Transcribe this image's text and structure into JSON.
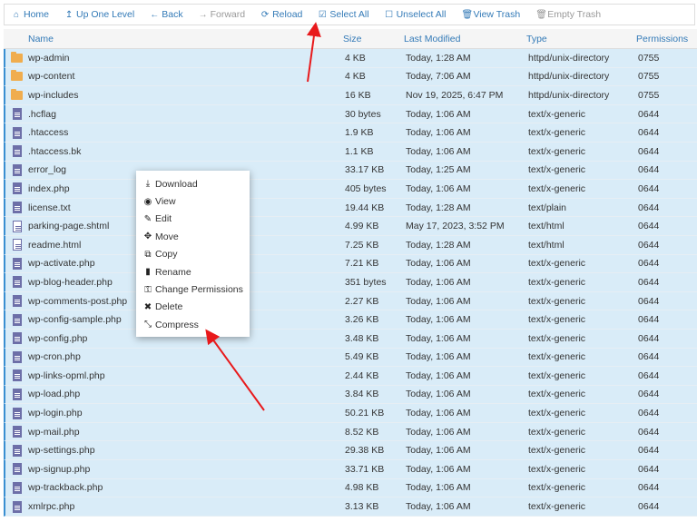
{
  "toolbar": [
    {
      "label": "Home",
      "icon": "home-icon",
      "glyph": "⌂",
      "disabled": false
    },
    {
      "label": "Up One Level",
      "icon": "level-up-icon",
      "glyph": "↥",
      "disabled": false
    },
    {
      "label": "Back",
      "icon": "arrow-left-icon",
      "glyph": "←",
      "disabled": false
    },
    {
      "label": "Forward",
      "icon": "arrow-right-icon",
      "glyph": "→",
      "disabled": true
    },
    {
      "label": "Reload",
      "icon": "refresh-icon",
      "glyph": "⟳",
      "disabled": false
    },
    {
      "label": "Select All",
      "icon": "checkbox-checked-icon",
      "glyph": "☑",
      "disabled": false
    },
    {
      "label": "Unselect All",
      "icon": "checkbox-empty-icon",
      "glyph": "☐",
      "disabled": false
    },
    {
      "label": "View Trash",
      "icon": "trash-icon",
      "glyph": "🗑",
      "disabled": false
    },
    {
      "label": "Empty Trash",
      "icon": "trash-icon",
      "glyph": "🗑",
      "disabled": true
    }
  ],
  "columns": [
    "Name",
    "Size",
    "Last Modified",
    "Type",
    "Permissions"
  ],
  "files": [
    {
      "name": "wp-admin",
      "size": "4 KB",
      "modified": "Today, 1:28 AM",
      "type": "httpd/unix-directory",
      "perm": "0755",
      "kind": "folder"
    },
    {
      "name": "wp-content",
      "size": "4 KB",
      "modified": "Today, 7:06 AM",
      "type": "httpd/unix-directory",
      "perm": "0755",
      "kind": "folder"
    },
    {
      "name": "wp-includes",
      "size": "16 KB",
      "modified": "Nov 19, 2025, 6:47 PM",
      "type": "httpd/unix-directory",
      "perm": "0755",
      "kind": "folder"
    },
    {
      "name": ".hcflag",
      "size": "30 bytes",
      "modified": "Today, 1:06 AM",
      "type": "text/x-generic",
      "perm": "0644",
      "kind": "file"
    },
    {
      "name": ".htaccess",
      "size": "1.9 KB",
      "modified": "Today, 1:06 AM",
      "type": "text/x-generic",
      "perm": "0644",
      "kind": "file"
    },
    {
      "name": ".htaccess.bk",
      "size": "1.1 KB",
      "modified": "Today, 1:06 AM",
      "type": "text/x-generic",
      "perm": "0644",
      "kind": "file"
    },
    {
      "name": "error_log",
      "size": "33.17 KB",
      "modified": "Today, 1:25 AM",
      "type": "text/x-generic",
      "perm": "0644",
      "kind": "file"
    },
    {
      "name": "index.php",
      "size": "405 bytes",
      "modified": "Today, 1:06 AM",
      "type": "text/x-generic",
      "perm": "0644",
      "kind": "file"
    },
    {
      "name": "license.txt",
      "size": "19.44 KB",
      "modified": "Today, 1:28 AM",
      "type": "text/plain",
      "perm": "0644",
      "kind": "file"
    },
    {
      "name": "parking-page.shtml",
      "size": "4.99 KB",
      "modified": "May 17, 2023, 3:52 PM",
      "type": "text/html",
      "perm": "0644",
      "kind": "html"
    },
    {
      "name": "readme.html",
      "size": "7.25 KB",
      "modified": "Today, 1:28 AM",
      "type": "text/html",
      "perm": "0644",
      "kind": "html"
    },
    {
      "name": "wp-activate.php",
      "size": "7.21 KB",
      "modified": "Today, 1:06 AM",
      "type": "text/x-generic",
      "perm": "0644",
      "kind": "file"
    },
    {
      "name": "wp-blog-header.php",
      "size": "351 bytes",
      "modified": "Today, 1:06 AM",
      "type": "text/x-generic",
      "perm": "0644",
      "kind": "file"
    },
    {
      "name": "wp-comments-post.php",
      "size": "2.27 KB",
      "modified": "Today, 1:06 AM",
      "type": "text/x-generic",
      "perm": "0644",
      "kind": "file"
    },
    {
      "name": "wp-config-sample.php",
      "size": "3.26 KB",
      "modified": "Today, 1:06 AM",
      "type": "text/x-generic",
      "perm": "0644",
      "kind": "file"
    },
    {
      "name": "wp-config.php",
      "size": "3.48 KB",
      "modified": "Today, 1:06 AM",
      "type": "text/x-generic",
      "perm": "0644",
      "kind": "file"
    },
    {
      "name": "wp-cron.php",
      "size": "5.49 KB",
      "modified": "Today, 1:06 AM",
      "type": "text/x-generic",
      "perm": "0644",
      "kind": "file"
    },
    {
      "name": "wp-links-opml.php",
      "size": "2.44 KB",
      "modified": "Today, 1:06 AM",
      "type": "text/x-generic",
      "perm": "0644",
      "kind": "file"
    },
    {
      "name": "wp-load.php",
      "size": "3.84 KB",
      "modified": "Today, 1:06 AM",
      "type": "text/x-generic",
      "perm": "0644",
      "kind": "file"
    },
    {
      "name": "wp-login.php",
      "size": "50.21 KB",
      "modified": "Today, 1:06 AM",
      "type": "text/x-generic",
      "perm": "0644",
      "kind": "file"
    },
    {
      "name": "wp-mail.php",
      "size": "8.52 KB",
      "modified": "Today, 1:06 AM",
      "type": "text/x-generic",
      "perm": "0644",
      "kind": "file"
    },
    {
      "name": "wp-settings.php",
      "size": "29.38 KB",
      "modified": "Today, 1:06 AM",
      "type": "text/x-generic",
      "perm": "0644",
      "kind": "file"
    },
    {
      "name": "wp-signup.php",
      "size": "33.71 KB",
      "modified": "Today, 1:06 AM",
      "type": "text/x-generic",
      "perm": "0644",
      "kind": "file"
    },
    {
      "name": "wp-trackback.php",
      "size": "4.98 KB",
      "modified": "Today, 1:06 AM",
      "type": "text/x-generic",
      "perm": "0644",
      "kind": "file"
    },
    {
      "name": "xmlrpc.php",
      "size": "3.13 KB",
      "modified": "Today, 1:06 AM",
      "type": "text/x-generic",
      "perm": "0644",
      "kind": "file"
    }
  ],
  "context_menu": [
    {
      "label": "Download",
      "icon": "download-icon",
      "glyph": "⤓"
    },
    {
      "label": "View",
      "icon": "eye-icon",
      "glyph": "◉"
    },
    {
      "label": "Edit",
      "icon": "pencil-icon",
      "glyph": "✎"
    },
    {
      "label": "Move",
      "icon": "move-icon",
      "glyph": "✥"
    },
    {
      "label": "Copy",
      "icon": "copy-icon",
      "glyph": "⧉"
    },
    {
      "label": "Rename",
      "icon": "file-icon",
      "glyph": "▮"
    },
    {
      "label": "Change Permissions",
      "icon": "key-icon",
      "glyph": "⚿"
    },
    {
      "label": "Delete",
      "icon": "close-icon",
      "glyph": "✖"
    },
    {
      "label": "Compress",
      "icon": "compress-icon",
      "glyph": "⤡"
    }
  ],
  "colors": {
    "link": "#337ab7",
    "selected_row": "#d9ecf8",
    "annotation": "#e8191b"
  }
}
